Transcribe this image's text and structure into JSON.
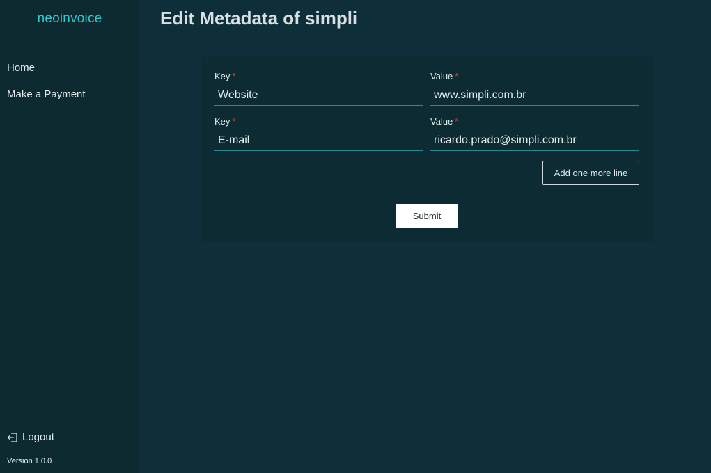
{
  "sidebar": {
    "brand": "neoinvoice",
    "items": [
      {
        "label": "Home"
      },
      {
        "label": "Make a Payment"
      }
    ],
    "logout_label": "Logout",
    "logout_icon": "logout-icon",
    "version": "Version 1.0.0"
  },
  "main": {
    "title": "Edit Metadata of simpli",
    "rows": [
      {
        "key_label": "Key",
        "key_value": "Website",
        "value_label": "Value",
        "value_value": "www.simpli.com.br"
      },
      {
        "key_label": "Key",
        "key_value": "E-mail",
        "value_label": "Value",
        "value_value": "ricardo.prado@simpli.com.br"
      }
    ],
    "required_mark": "*",
    "add_line_label": "Add one more line",
    "submit_label": "Submit"
  },
  "colors": {
    "background": "#0e2e39",
    "sidebar": "#0c2a30",
    "brand": "#2ec9cc",
    "input_underline": "#2a8a94",
    "required": "#e53935"
  }
}
